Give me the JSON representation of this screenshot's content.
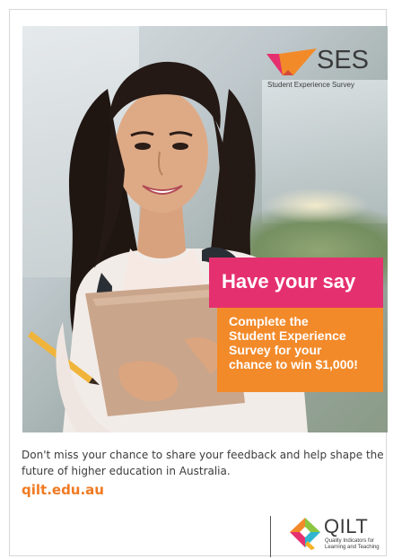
{
  "brand": {
    "ses_name": "SES",
    "ses_subtitle": "Student Experience Survey",
    "qilt_name": "QILT",
    "qilt_sub_line1": "Quality Indicators for",
    "qilt_sub_line2": "Learning and Teaching"
  },
  "hero": {
    "headline": "Have your say",
    "offer_lines": [
      "Complete the",
      "Student Experience",
      "Survey for your",
      "chance to win $1,000!"
    ]
  },
  "body": {
    "message": "Don't miss your chance to share your feedback and help shape the future of higher education in Australia.",
    "link_text": "qilt.edu.au"
  },
  "colors": {
    "headline_bg": "#e5306f",
    "offer_bg": "#f28a2a",
    "link": "#f07a22",
    "text": "#3c3c3c"
  },
  "icons": {
    "ses_logo_mark": "ses-chevron-icon",
    "qilt_logo_mark": "qilt-diamond-icon",
    "hero_image": "student-photo"
  }
}
